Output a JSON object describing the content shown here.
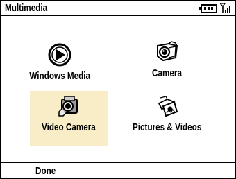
{
  "header": {
    "title": "Multimedia",
    "icons": [
      "battery-icon",
      "signal-icon"
    ]
  },
  "menu": {
    "items": [
      {
        "label": "Windows Media",
        "icon": "windows-media-icon",
        "selected": false
      },
      {
        "label": "Camera",
        "icon": "camera-icon",
        "selected": false
      },
      {
        "label": "Video Camera",
        "icon": "video-camera-icon",
        "selected": true
      },
      {
        "label": "Pictures & Videos",
        "icon": "pictures-videos-icon",
        "selected": false
      }
    ]
  },
  "softkeys": {
    "left": "Done"
  },
  "colors": {
    "selection_bg": "#f8edc6"
  }
}
